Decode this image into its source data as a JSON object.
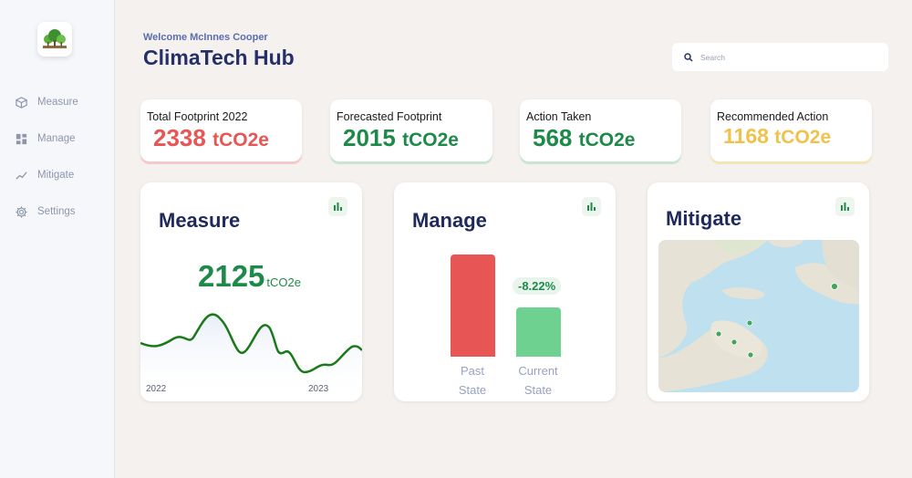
{
  "sidebar": {
    "logo": "tree-logo",
    "items": [
      {
        "label": "Measure",
        "icon": "box-icon"
      },
      {
        "label": "Manage",
        "icon": "dashboard-icon"
      },
      {
        "label": "Mitigate",
        "icon": "trend-icon"
      },
      {
        "label": "Settings",
        "icon": "gear-icon"
      }
    ]
  },
  "header": {
    "welcome": "Welcome McInnes Cooper",
    "title": "ClimaTech Hub"
  },
  "search": {
    "placeholder": "Search"
  },
  "stats": [
    {
      "label": "Total Footprint 2022",
      "value": "2338",
      "unit": "tCO2e",
      "color": "#e85555"
    },
    {
      "label": "Forecasted Footprint",
      "value": "2015",
      "unit": "tCO2e",
      "color": "#1e8a4a"
    },
    {
      "label": "Action Taken",
      "value": "568",
      "unit": "tCO2e",
      "color": "#1e8a4a"
    },
    {
      "label": "Recommended Action",
      "value": "1168",
      "unit": "tCO2e",
      "color": "#f0c24b"
    }
  ],
  "measure": {
    "title": "Measure",
    "value": "2125",
    "unit": "tCO2e",
    "year_start": "2022",
    "year_end": "2023"
  },
  "manage": {
    "title": "Manage",
    "change": "-8.22%",
    "past_label_1": "Past",
    "past_label_2": "State",
    "current_label_1": "Current",
    "current_label_2": "State"
  },
  "mitigate": {
    "title": "Mitigate"
  },
  "colors": {
    "accent_green": "#1e8a4a",
    "accent_red": "#e85555",
    "accent_yellow": "#f0c24b",
    "light_green": "#6fd190",
    "navy": "#1f2a5a"
  }
}
